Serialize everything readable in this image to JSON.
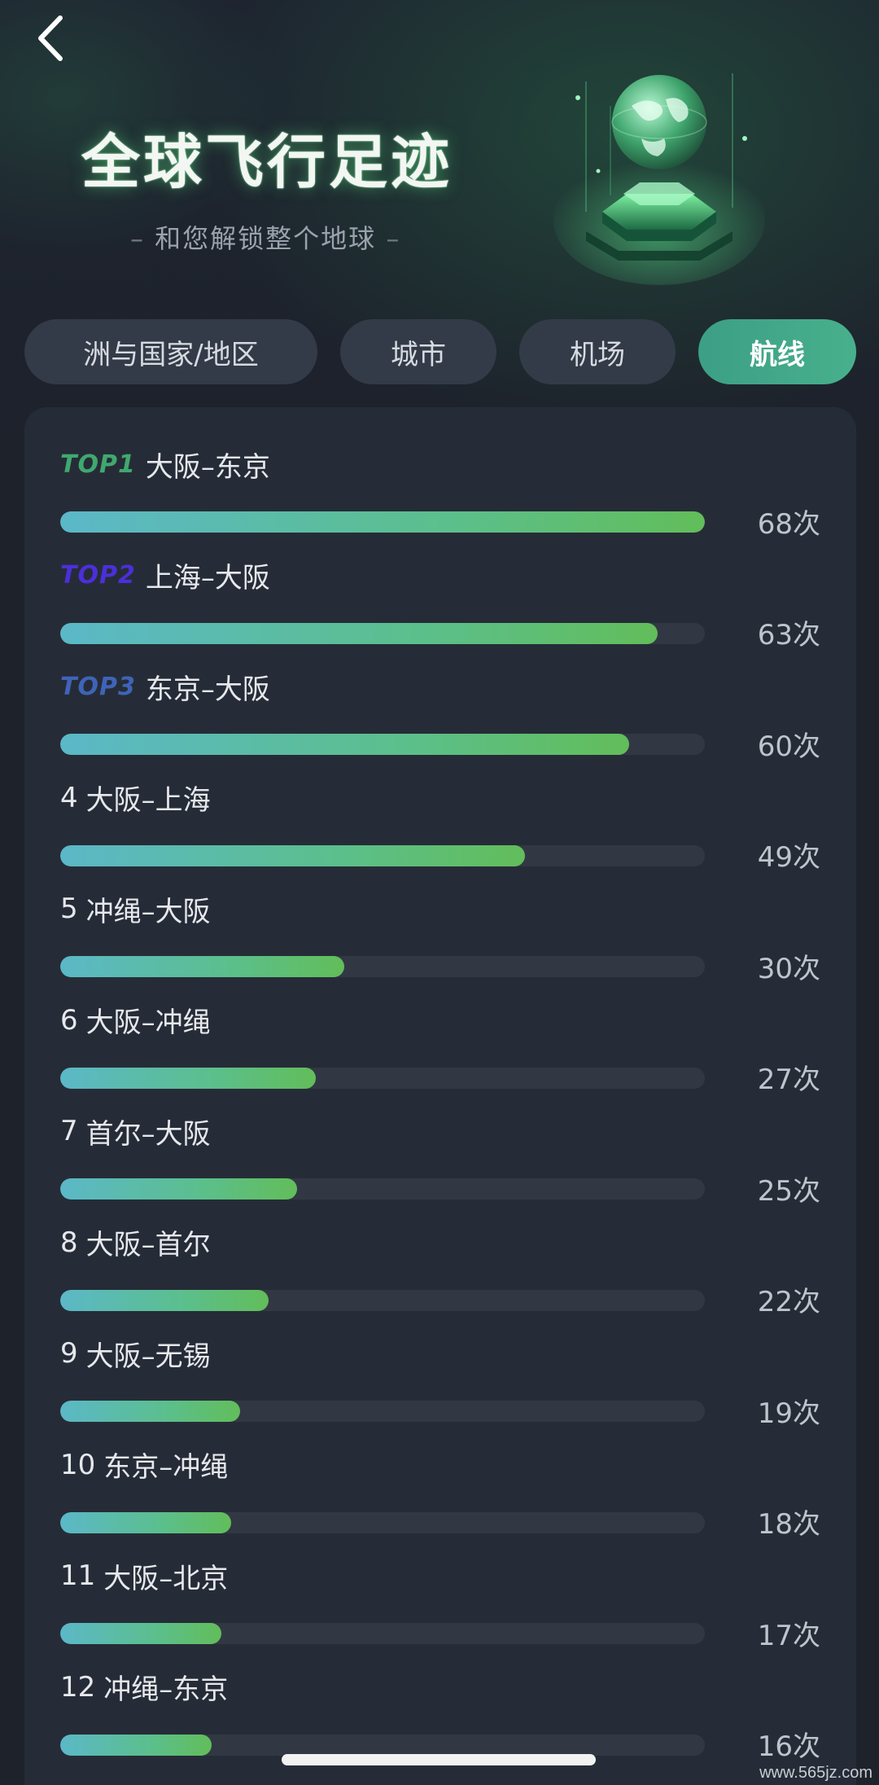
{
  "header": {
    "title": "全球飞行足迹",
    "subtitle": "和您解锁整个地球",
    "subtitle_dash_left": "–",
    "subtitle_dash_right": "–"
  },
  "tabs": [
    {
      "label": "洲与国家/地区",
      "active": false
    },
    {
      "label": "城市",
      "active": false
    },
    {
      "label": "机场",
      "active": false
    },
    {
      "label": "航线",
      "active": true
    }
  ],
  "colors": {
    "top1": "#3fa86f",
    "top2": "#4b2fd9",
    "top3": "#3f63b8",
    "accent": "#48b08c"
  },
  "max_count": 68,
  "routes": [
    {
      "badge": "TOP1",
      "rank": "",
      "route": "大阪–东京",
      "count": 68,
      "count_label": "68次"
    },
    {
      "badge": "TOP2",
      "rank": "",
      "route": "上海–大阪",
      "count": 63,
      "count_label": "63次"
    },
    {
      "badge": "TOP3",
      "rank": "",
      "route": "东京–大阪",
      "count": 60,
      "count_label": "60次"
    },
    {
      "badge": "",
      "rank": "4",
      "route": "大阪–上海",
      "count": 49,
      "count_label": "49次"
    },
    {
      "badge": "",
      "rank": "5",
      "route": "冲绳–大阪",
      "count": 30,
      "count_label": "30次"
    },
    {
      "badge": "",
      "rank": "6",
      "route": "大阪–冲绳",
      "count": 27,
      "count_label": "27次"
    },
    {
      "badge": "",
      "rank": "7",
      "route": "首尔–大阪",
      "count": 25,
      "count_label": "25次"
    },
    {
      "badge": "",
      "rank": "8",
      "route": "大阪–首尔",
      "count": 22,
      "count_label": "22次"
    },
    {
      "badge": "",
      "rank": "9",
      "route": "大阪–无锡",
      "count": 19,
      "count_label": "19次"
    },
    {
      "badge": "",
      "rank": "10",
      "route": "东京–冲绳",
      "count": 18,
      "count_label": "18次"
    },
    {
      "badge": "",
      "rank": "11",
      "route": "大阪–北京",
      "count": 17,
      "count_label": "17次"
    },
    {
      "badge": "",
      "rank": "12",
      "route": "冲绳–东京",
      "count": 16,
      "count_label": "16次"
    }
  ],
  "watermark": "www.565jz.com"
}
